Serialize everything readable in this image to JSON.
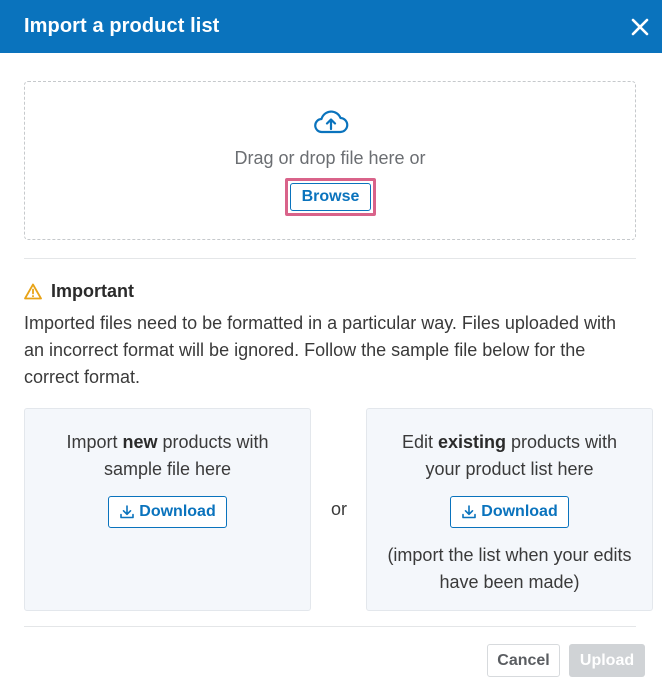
{
  "dialog": {
    "title": "Import a product list",
    "close_icon": "close-icon"
  },
  "dropzone": {
    "icon": "cloud-upload-icon",
    "hint": "Drag or drop file here or",
    "browse_label": "Browse"
  },
  "important": {
    "icon": "warning-icon",
    "label": "Important",
    "text": "Imported files need to be formatted in a particular way. Files uploaded with an incorrect format will be ignored. Follow the sample file below for the correct format."
  },
  "cards": {
    "new": {
      "prefix": "Import ",
      "emphasis": "new",
      "suffix": " products with sample file here",
      "button_label": "Download",
      "button_icon": "download-icon"
    },
    "separator": "or",
    "existing": {
      "prefix": "Edit ",
      "emphasis": "existing",
      "suffix": " products with your product list here",
      "button_label": "Download",
      "button_icon": "download-icon",
      "note": "(import the list when your edits have been made)"
    }
  },
  "footer": {
    "cancel_label": "Cancel",
    "upload_label": "Upload"
  },
  "colors": {
    "header": "#0a73bd",
    "accent": "#0a73bd",
    "highlight_border": "#d9638a",
    "warning": "#e8a317",
    "disabled": "#d0d3d6"
  }
}
